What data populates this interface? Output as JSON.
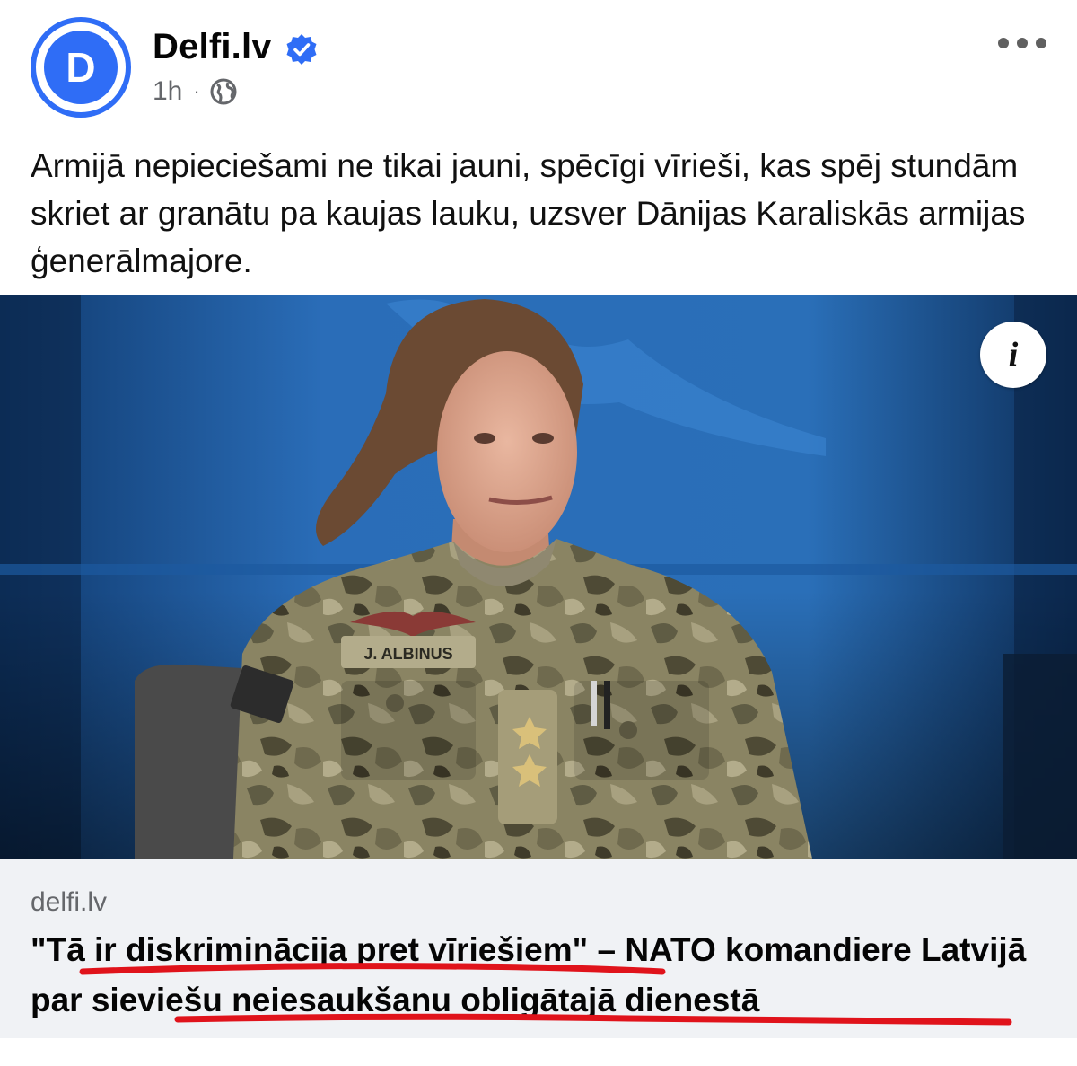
{
  "post": {
    "page_name": "Delfi.lv",
    "avatar_letter": "D",
    "time": "1h",
    "separator": "·",
    "text": "Armijā nepieciešami ne tikai jauni, spēcīgi vīrieši, kas spēj stundām skriet ar granātu pa kaujas lauku, uzsver Dānijas Karaliskās armijas ģenerālmajore.",
    "more_icon": "more-horizontal-icon",
    "privacy_icon": "globe-icon"
  },
  "photo": {
    "name_tape": "J. ALBINUS",
    "info_label": "i"
  },
  "link": {
    "domain": "delfi.lv",
    "title": "\"Tā ir diskriminācija pret vīriešiem\" – NATO komandiere Latvijā par sieviešu neiesaukšanu obligātajā dienestā"
  },
  "colors": {
    "brand_blue": "#2f6df6",
    "annotation_red": "#e0131b",
    "card_bg": "#f0f2f5"
  }
}
